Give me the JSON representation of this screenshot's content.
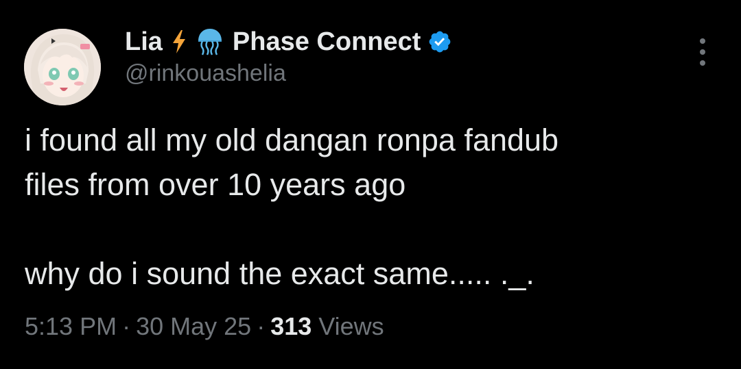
{
  "author": {
    "display_name": "Lia",
    "affiliation": "Phase Connect",
    "handle": "@rinkouashelia",
    "emoji_1": "lightning-bolt",
    "emoji_2": "jellyfish",
    "verified": true
  },
  "tweet": {
    "line_1": "i found all my old dangan ronpa fandub",
    "line_2": "files from over 10 years ago",
    "line_3": "why do i sound the exact same..... ._."
  },
  "meta": {
    "time": "5:13 PM",
    "separator": "·",
    "date": "30 May 25",
    "views_count": "313",
    "views_label": "Views"
  },
  "colors": {
    "background": "#000000",
    "primary_text": "#e7e9ea",
    "secondary_text": "#71767b",
    "verified_badge": "#1d9bf0",
    "bolt": "#f4a43a",
    "jellyfish": "#5ab7e8"
  }
}
